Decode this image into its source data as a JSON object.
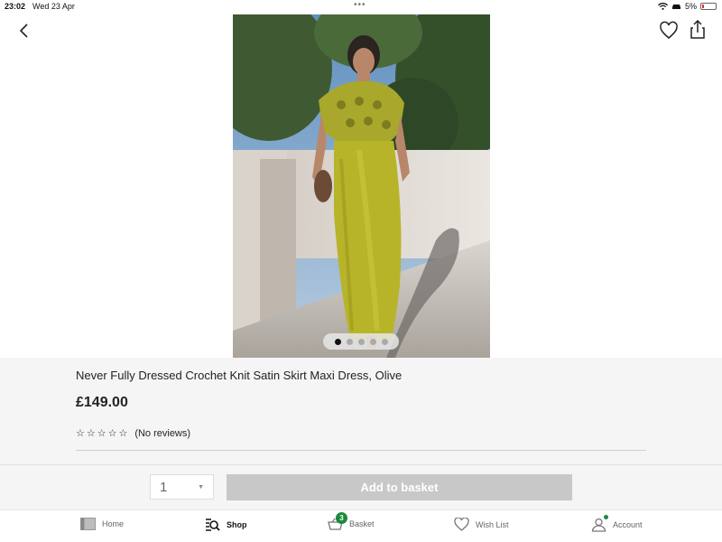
{
  "status": {
    "time": "23:02",
    "date": "Wed 23 Apr",
    "dots": "•••",
    "battery": "5%"
  },
  "product": {
    "title": "Never Fully Dressed Crochet Knit Satin Skirt Maxi Dress, Olive",
    "price": "£149.00",
    "stars": "☆☆☆☆☆",
    "reviews": "(No reviews)",
    "image_count": 5,
    "active_image": 1
  },
  "purchase": {
    "quantity": "1",
    "add_label": "Add to basket"
  },
  "tabs": [
    {
      "label": "Home",
      "icon": "home-icon"
    },
    {
      "label": "Shop",
      "icon": "shop-search-icon",
      "active": true
    },
    {
      "label": "Basket",
      "icon": "basket-icon",
      "badge": "3"
    },
    {
      "label": "Wish List",
      "icon": "heart-icon"
    },
    {
      "label": "Account",
      "icon": "account-icon"
    }
  ],
  "colors": {
    "accent_green": "#1a8a3a",
    "button_disabled": "#c8c8c8",
    "dress_olive": "#b8b42a"
  }
}
